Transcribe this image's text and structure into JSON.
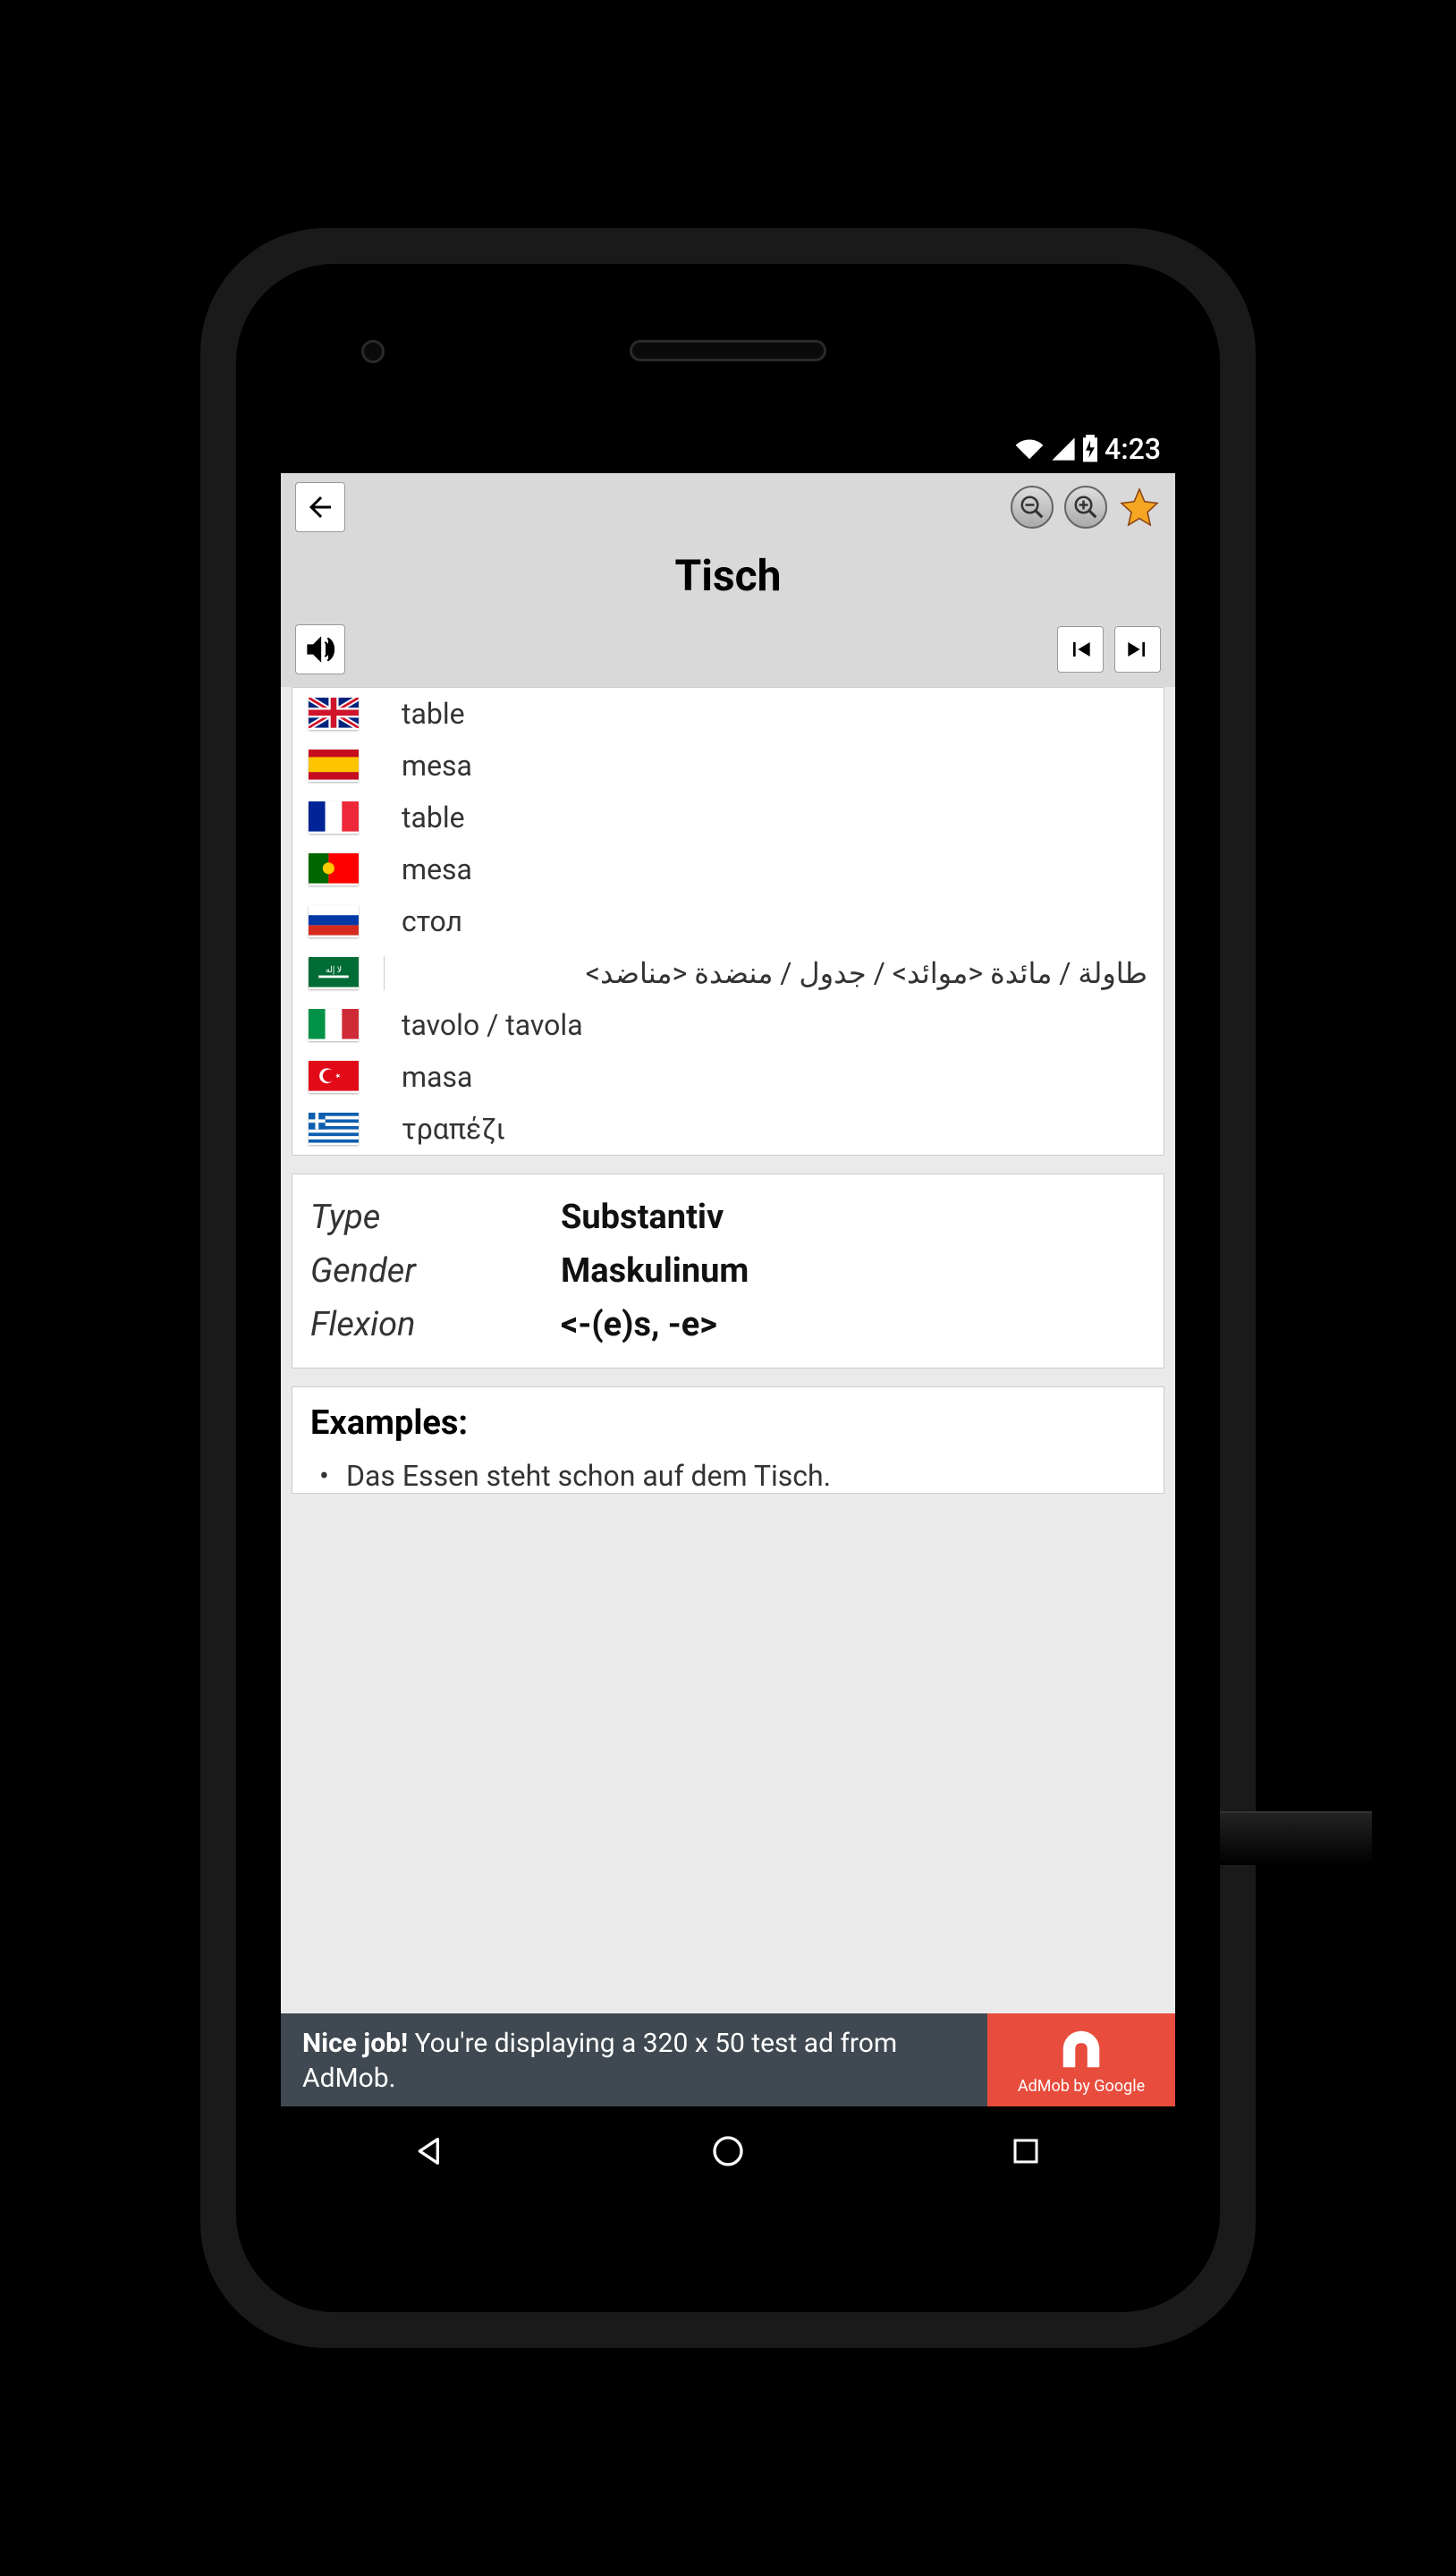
{
  "status": {
    "time": "4:23"
  },
  "header": {
    "title": "Tisch"
  },
  "translations": [
    {
      "flag": "gb",
      "text": "table"
    },
    {
      "flag": "es",
      "text": "mesa"
    },
    {
      "flag": "fr",
      "text": "table"
    },
    {
      "flag": "pt",
      "text": "mesa"
    },
    {
      "flag": "ru",
      "text": "стол"
    },
    {
      "flag": "ar",
      "text": "طاولة / مائدة <موائد> / جدول / منضدة <مناضد>",
      "rtl": true
    },
    {
      "flag": "it",
      "text": "tavolo / tavola"
    },
    {
      "flag": "tr",
      "text": "masa"
    },
    {
      "flag": "gr",
      "text": "τραπέζι"
    }
  ],
  "info": {
    "type_label": "Type",
    "type_value": "Substantiv",
    "gender_label": "Gender",
    "gender_value": "Maskulinum",
    "flexion_label": "Flexion",
    "flexion_value": "<-(e)s, -e>"
  },
  "examples": {
    "title": "Examples:",
    "items": [
      "Das Essen steht schon auf dem Tisch."
    ]
  },
  "ad": {
    "bold": "Nice job!",
    "rest": " You're displaying a 320 x 50 test ad from AdMob.",
    "badge": "AdMob by Google"
  }
}
